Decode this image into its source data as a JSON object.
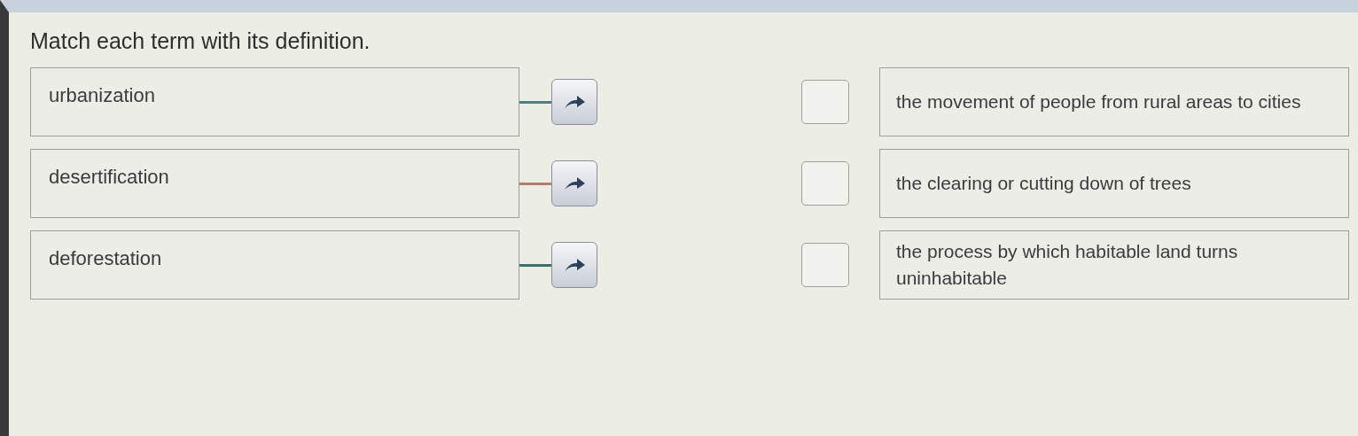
{
  "prompt": "Match each term with its definition.",
  "terms": [
    {
      "text": "urbanization",
      "color": "#4f7f78"
    },
    {
      "text": "desertification",
      "color": "#b0806c"
    },
    {
      "text": "deforestation",
      "color": "#3f6f6c"
    }
  ],
  "definitions": [
    {
      "text": "the movement of people from rural areas to cities"
    },
    {
      "text": "the clearing or cutting down of trees"
    },
    {
      "text": "the process by which habitable land turns uninhabitable"
    }
  ]
}
